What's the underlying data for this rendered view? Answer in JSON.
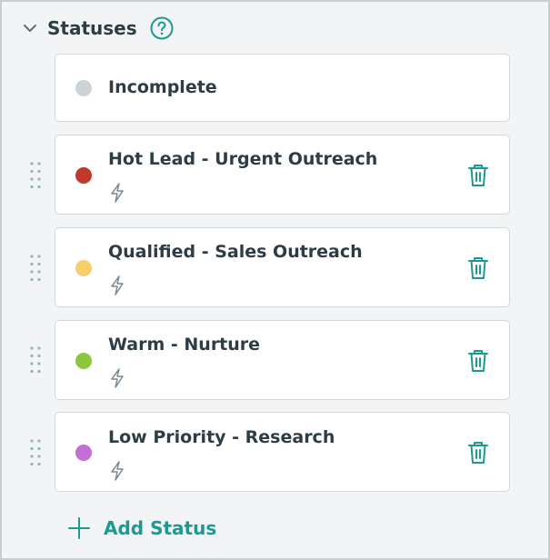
{
  "section": {
    "title": "Statuses",
    "help_icon": "question-circle-icon",
    "collapse_icon": "chevron-down-icon"
  },
  "statuses": [
    {
      "label": "Incomplete",
      "color": "#ccd2d5",
      "has_action": false,
      "deletable": false,
      "draggable": false
    },
    {
      "label": "Hot Lead - Urgent Outreach",
      "color": "#c0392b",
      "has_action": true,
      "deletable": true,
      "draggable": true
    },
    {
      "label": "Qualified - Sales Outreach",
      "color": "#f7cf6a",
      "has_action": true,
      "deletable": true,
      "draggable": true
    },
    {
      "label": "Warm - Nurture",
      "color": "#8dc63f",
      "has_action": true,
      "deletable": true,
      "draggable": true
    },
    {
      "label": "Low Priority - Research",
      "color": "#c26fd6",
      "has_action": true,
      "deletable": true,
      "draggable": true
    }
  ],
  "add_status": {
    "label": "Add Status",
    "icon": "plus-icon"
  },
  "colors": {
    "accent": "#1a9a90",
    "text": "#2d3d45",
    "panel_bg": "#f2f4f5",
    "card_border": "#d3d8db",
    "icon_gray": "#7a8a92"
  }
}
